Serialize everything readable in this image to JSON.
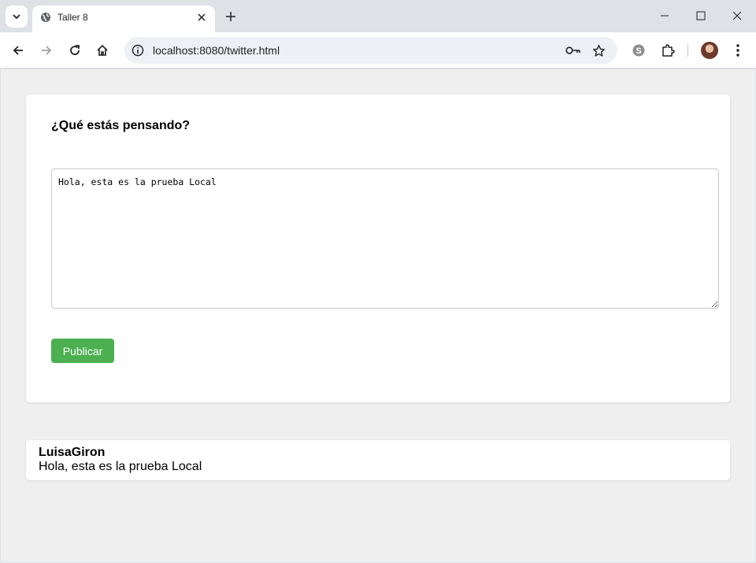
{
  "browser": {
    "tab_title": "Taller 8",
    "url": "localhost:8080/twitter.html"
  },
  "composer": {
    "heading": "¿Qué estás pensando?",
    "textarea_value": "Hola, esta es la prueba Local",
    "publish_label": "Publicar",
    "publish_color": "#4caf50"
  },
  "posts": [
    {
      "user": "LuisaGiron",
      "text": "Hola, esta es la prueba Local"
    }
  ],
  "icons": {
    "tab_search": "chevron-down-icon",
    "favicon": "globe-icon",
    "tab_close": "close-icon",
    "new_tab": "plus-icon",
    "minimize": "minimize-icon",
    "maximize": "maximize-icon",
    "close_window": "close-icon",
    "back": "arrow-left-icon",
    "forward": "arrow-right-icon",
    "reload": "reload-icon",
    "home": "home-icon",
    "site_info": "info-icon",
    "password": "key-icon",
    "bookmark": "star-icon",
    "skype": "skype-icon",
    "extensions": "puzzle-icon",
    "menu": "kebab-menu-icon"
  }
}
